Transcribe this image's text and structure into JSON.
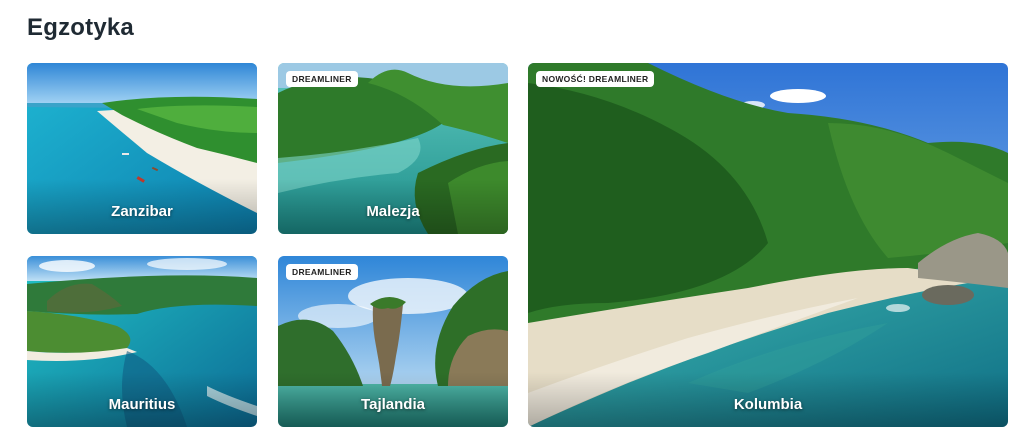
{
  "section": {
    "title": "Egzotyka"
  },
  "cards": [
    {
      "name": "Zanzibar",
      "badge": ""
    },
    {
      "name": "Malezja",
      "badge": "DREAMLINER"
    },
    {
      "name": "Mauritius",
      "badge": ""
    },
    {
      "name": "Tajlandia",
      "badge": "DREAMLINER"
    },
    {
      "name": "Kolumbia",
      "badge": "NOWOŚĆ! DREAMLINER"
    }
  ],
  "colors": {
    "title": "#1f2a33",
    "badge_bg": "#ffffff",
    "label": "#ffffff"
  }
}
